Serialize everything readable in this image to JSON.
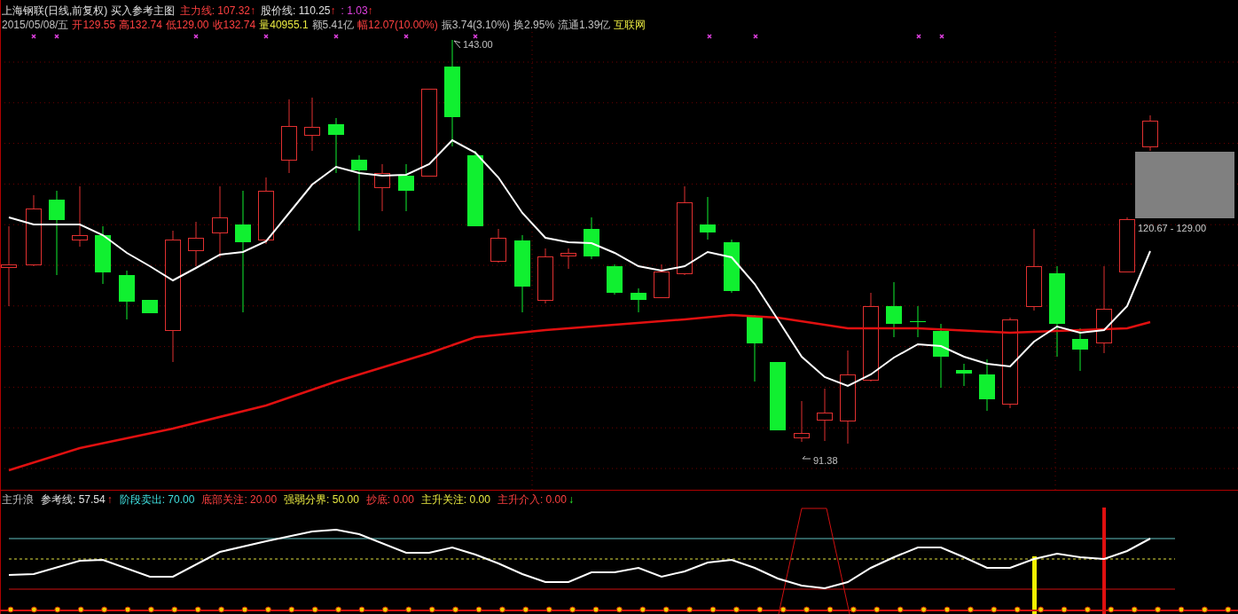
{
  "header": {
    "line_1": [
      {
        "text": "上海钢联(日线,前复权) 买入参考主图",
        "kind": "title"
      },
      {
        "text": "主力线: 107.32",
        "kind": "main"
      },
      {
        "text": "↑",
        "kind": "rise"
      },
      {
        "text": "股价线: 110.25",
        "kind": "title"
      },
      {
        "text": "↑",
        "kind": "rise"
      },
      {
        "text": ": 1.03",
        "kind": "extra"
      },
      {
        "text": "↑",
        "kind": "rise"
      }
    ],
    "line_2": [
      {
        "text": "2015/05/08/五",
        "kind": "info"
      },
      {
        "text": "开129.55",
        "kind": "main"
      },
      {
        "text": "高132.74",
        "kind": "main"
      },
      {
        "text": "低129.00",
        "kind": "main"
      },
      {
        "text": "收132.74",
        "kind": "main"
      },
      {
        "text": "量40955.1",
        "kind": "volume"
      },
      {
        "text": "额5.41亿",
        "kind": "info"
      },
      {
        "text": "幅12.07(10.00%)",
        "kind": "main"
      },
      {
        "text": "振3.74(3.10%)",
        "kind": "info"
      },
      {
        "text": "换2.95%",
        "kind": "info"
      },
      {
        "text": "流通1.39亿",
        "kind": "info"
      },
      {
        "text": "互联网",
        "kind": "volume"
      }
    ]
  },
  "price_labels": {
    "high": "143.00",
    "low": "91.38",
    "range": "120.67 - 129.00"
  },
  "indicator_header": [
    {
      "text": "主升浪",
      "kind": "info"
    },
    {
      "text": "参考线: 57.54",
      "kind": "title"
    },
    {
      "text": "↑",
      "kind": "rise"
    },
    {
      "text": "阶段卖出: 70.00",
      "kind": "sell"
    },
    {
      "text": "底部关注: 20.00",
      "kind": "main"
    },
    {
      "text": "强弱分界: 50.00",
      "kind": "volume"
    },
    {
      "text": "抄底: 0.00",
      "kind": "main"
    },
    {
      "text": "主升关注: 0.00",
      "kind": "volume"
    },
    {
      "text": "主升介入: 0.00",
      "kind": "main"
    },
    {
      "text": "↓",
      "kind": "fall"
    }
  ]
}
